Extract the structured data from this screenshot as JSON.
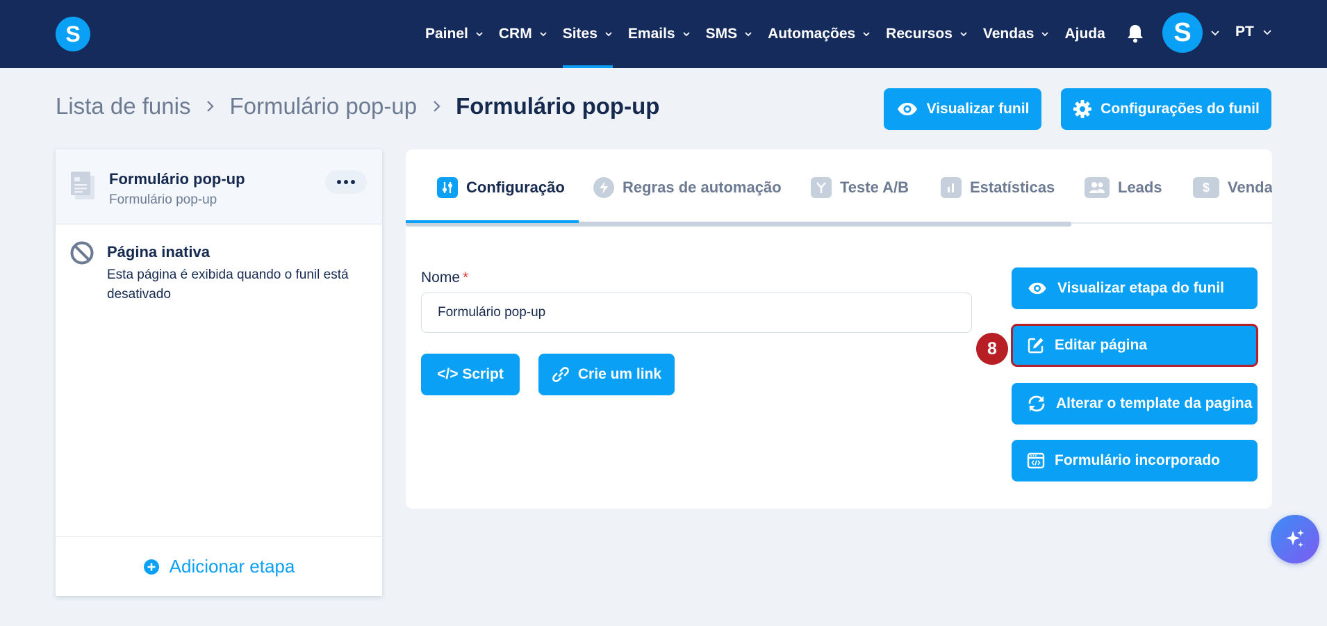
{
  "nav": {
    "logo": "S",
    "items": [
      {
        "label": "Painel",
        "has_dropdown": true
      },
      {
        "label": "CRM",
        "has_dropdown": true
      },
      {
        "label": "Sites",
        "has_dropdown": true,
        "active": true
      },
      {
        "label": "Emails",
        "has_dropdown": true
      },
      {
        "label": "SMS",
        "has_dropdown": true
      },
      {
        "label": "Automações",
        "has_dropdown": true
      },
      {
        "label": "Recursos",
        "has_dropdown": true
      },
      {
        "label": "Vendas",
        "has_dropdown": true
      },
      {
        "label": "Ajuda",
        "has_dropdown": false
      }
    ],
    "bell_icon": "bell-icon",
    "avatar_initial": "S",
    "language": "PT"
  },
  "breadcrumb": {
    "items": [
      "Lista de funis",
      "Formulário pop-up"
    ],
    "current": "Formulário pop-up"
  },
  "header_actions": {
    "preview_label": "Visualizar funil",
    "settings_label": "Configurações do funil"
  },
  "sidebar": {
    "active_step": {
      "title": "Formulário pop-up",
      "subtitle": "Formulário pop-up"
    },
    "inactive_page": {
      "title": "Página inativa",
      "description": "Esta página é exibida quando o funil está desativado"
    },
    "add_step_label": "Adicionar etapa"
  },
  "tabs": [
    {
      "label": "Configuração",
      "icon": "sliders-icon",
      "active": true
    },
    {
      "label": "Regras de automação",
      "icon": "bolt-icon"
    },
    {
      "label": "Teste A/B",
      "icon": "split-icon"
    },
    {
      "label": "Estatísticas",
      "icon": "bar-chart-icon"
    },
    {
      "label": "Leads",
      "icon": "users-icon"
    },
    {
      "label": "Vendas",
      "icon": "dollar-icon"
    }
  ],
  "form": {
    "name_label": "Nome",
    "required_mark": "*",
    "name_value": "Formulário pop-up",
    "script_label": "</> Script",
    "link_label": "Crie um link"
  },
  "side_actions": {
    "preview_step": "Visualizar etapa do funil",
    "edit_page": "Editar página",
    "change_template": "Alterar o template da pagina",
    "embedded_form": "Formulário incorporado"
  },
  "annotation": {
    "step_number": "8"
  },
  "colors": {
    "nav_bg": "#152b5c",
    "accent": "#0aa0f5",
    "page_bg": "#eff3f8",
    "highlight": "#b3222c",
    "text_dark": "#16294f",
    "text_muted": "#6c7a92"
  }
}
